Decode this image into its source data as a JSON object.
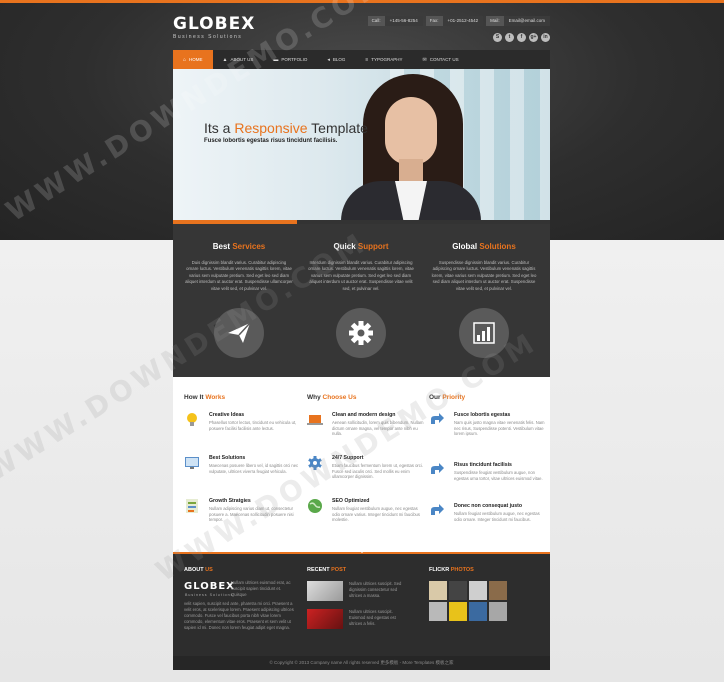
{
  "header": {
    "logo_title": "GLOBEX",
    "logo_sub": "Business Solutions",
    "contacts": [
      {
        "label": "Call:",
        "value": "+145-56-8254"
      },
      {
        "label": "Fax:",
        "value": "+01-2512-4542"
      },
      {
        "label": "Mail:",
        "value": "Email@email.com"
      }
    ],
    "socials": [
      "S",
      "t",
      "f",
      "g+",
      "in"
    ]
  },
  "nav": {
    "items": [
      {
        "label": "HOME",
        "icon": "home-icon"
      },
      {
        "label": "ABOUT US",
        "icon": "user-icon"
      },
      {
        "label": "PORTFOLIO",
        "icon": "car-icon"
      },
      {
        "label": "BLOG",
        "icon": "megaphone-icon"
      },
      {
        "label": "TYPOGRAPHY",
        "icon": "text-icon"
      },
      {
        "label": "CONTACT US",
        "icon": "mail-icon"
      }
    ]
  },
  "hero": {
    "title_pre": "Its a ",
    "title_accent": "Responsive",
    "title_post": " Template",
    "subtitle": "Fusce lobortis egestas risus tincidunt facilisis.",
    "slider_progress": 0.33
  },
  "services": [
    {
      "title_a": "Best ",
      "title_b": "Services",
      "text": "Duis dignissim blandit varius. Curabitur adipiscing ornare luctus. Vestibulum venenatis sagittis lorem, vitae varius sem vulputate pretium. Sed eget leo sed diam aliquet interdum ut auctor erat. Suspendisse ullamcorper vitae velit sed, et pulvinar vel.",
      "icon": "paper-plane-icon"
    },
    {
      "title_a": "Quick ",
      "title_b": "Support",
      "text": "Interdum dignissim blandit varius. Curabitur adipiscing ornare luctus. Vestibulum venenatis sagittis lorem, vitae varius sem vulputate pretium. Sed eget leo sed diam aliquet interdum ut auctor erat. Suspendisse vitae velit sed, et pulvinar vel.",
      "icon": "gear-icon"
    },
    {
      "title_a": "Global ",
      "title_b": "Solutions",
      "text": "Suspendisse dignissim blandit varius. Curabitur adipiscing ornare luctus. Vestibulum venenatis sagittis lorem, vitae varius sem vulputate pretium. Sed eget leo sed diam aliquet interdum ut auctor erat. Suspendisse vitae velit sed, et pulvinar vel.",
      "icon": "bar-chart-icon"
    }
  ],
  "features": [
    {
      "head_a": "How It ",
      "head_b": "Works",
      "items": [
        {
          "title": "Creative Ideas",
          "text": "Phasellus tortor lectus, tincidunt eu vehicula ut, posuere facilisi facilisis ante lectus.",
          "icon": "lightbulb-icon"
        },
        {
          "title": "Best Solutions",
          "text": "Maecenas posuere libero vel, id sagittis orci nec vulputate, ultrices viverra feugiat vehicula.",
          "icon": "monitor-icon"
        },
        {
          "title": "Growth Stratgies",
          "text": "Nullam adipiscing varius diam ut, consectetur posuere a. Maecenas sollicitudin posuere nisi tempor.",
          "icon": "list-icon"
        }
      ]
    },
    {
      "head_a": "Why ",
      "head_b": "Choose Us",
      "items": [
        {
          "title": "Clean and modern design",
          "text": "Aenean sollicitudin, lorem quis bibendum. Nullam dictum ornare magna, vel tempor ante nibh eu nulla.",
          "icon": "laptop-icon"
        },
        {
          "title": "24/7 Support",
          "text": "Etiam faucibus fermentum lorem ut, egestas orci. Fusce sed iaculis orci. Sed mollis eu enim ullamcorper dignissim.",
          "icon": "cog-icon"
        },
        {
          "title": "SEO Optimized",
          "text": "Nullam feugiat vestibulum augue, nec egestas odio ornare varius. Integer tincidunt mi faucibus molestie.",
          "icon": "globe-icon"
        }
      ]
    },
    {
      "head_a": "Our ",
      "head_b": "Priority",
      "items": [
        {
          "title": "Fusce lobortis egestas",
          "text": "Nam quis justo magna vitae venenatis felis. Nam nec risus, Suspendisse potenti. Vestibulum vitae lorem ipsum.",
          "icon": "arrow-icon"
        },
        {
          "title": "Risus tincidunt facilisis",
          "text": "Suspendisse feugiat vestibulum augue, non egestas urna tortor, vitae ultrices euismod vitae.",
          "icon": "arrow-icon"
        },
        {
          "title": "Donec non consequat justo",
          "text": "Nullam feugiat vestibulum augue, nec egestas odio ornare. Integer tincidunt mi faucibus.",
          "icon": "arrow-icon"
        }
      ]
    }
  ],
  "footer": {
    "about_head_a": "ABOUT ",
    "about_head_b": "US",
    "about_logo": "GLOBEX",
    "about_logo_sub": "Business Solutions",
    "about_text_right": "Nullam ultrices euismod erat, ac suscipit sapien tincidunt et. Quisque",
    "about_text": "velit sapien, suscipit sed ante, pharetra mi orci. Praesent a velit eros, at scelerisque lorem. Praesent adipiscing ultrices commodo. Fusce vel faucibus porta nibh vitae lorem commodo, elementum vitae eros. Praesent et sem velit ut sapien id mi. Donec non lorem feugiat adipit eget magna.",
    "recent_head_a": "RECENT ",
    "recent_head_b": "POST",
    "posts": [
      {
        "text": "Nullam ultrices suscipit. Sed dignissim consectetur sed ultrices a massa."
      },
      {
        "text": "Nullam ultrices suscipit. Euismod sed egestas est ultrices a felis."
      }
    ],
    "flickr_head_a": "FLICKR ",
    "flickr_head_b": "PHOTOS",
    "copyright": "© Copyright © 2013 Company name All rights reserved 更多模板 - More Templates 模板之家"
  },
  "watermark": "WWW.DOWNDEMO.COM"
}
